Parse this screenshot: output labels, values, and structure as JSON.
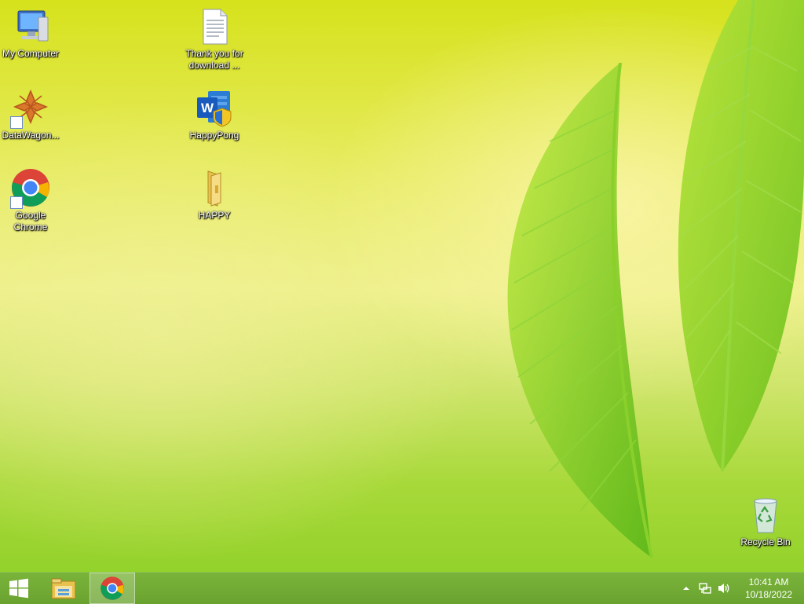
{
  "desktop": {
    "icons": [
      {
        "label": "My Computer"
      },
      {
        "label": "DataWagon..."
      },
      {
        "label": "Google Chrome"
      },
      {
        "label": "Thank you for download ..."
      },
      {
        "label": "HappyPong"
      },
      {
        "label": "HAPPY"
      },
      {
        "label": "Recycle Bin"
      }
    ]
  },
  "taskbar": {
    "clock_time": "10:41 AM",
    "clock_date": "10/18/2022"
  },
  "theme": {
    "taskbar_color": "#6aa230",
    "accent": "#8ccf26"
  }
}
